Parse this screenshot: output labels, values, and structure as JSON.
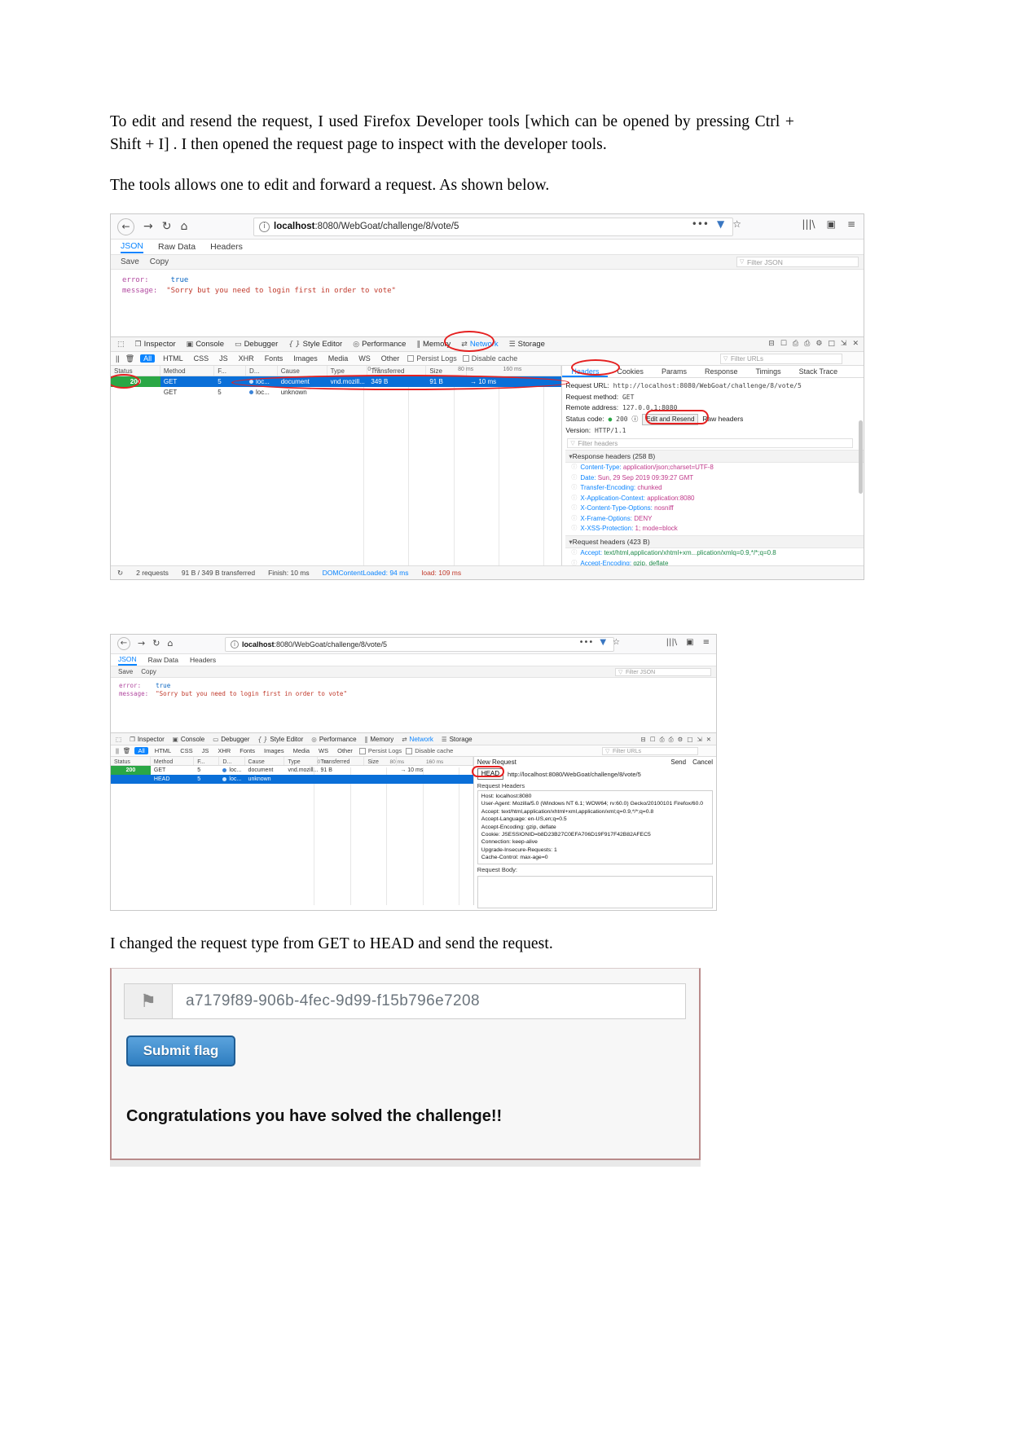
{
  "document": {
    "paragraph_1": "To edit and resend the request, I used Firefox Developer tools [which can be opened by pressing Ctrl + Shift + I] .  I then opened the request page to inspect with the developer tools.",
    "paragraph_2": "The tools allows one to edit and forward a request. As shown below.",
    "paragraph_3": "I changed the request type from GET to HEAD and send the request."
  },
  "browser": {
    "nav": {
      "back_icon": "←",
      "forward_icon": "→",
      "reload_icon": "↻",
      "home_icon": "⌂",
      "url": "localhost",
      "url_rest": ":8080/WebGoat/challenge/8/vote/5",
      "info_icon": "i",
      "menu_dots": "•••",
      "shield_icon": "▼",
      "star_icon": "☆",
      "library_icon": "|||\\",
      "sidebar_icon": "▣",
      "hamburger_icon": "≡"
    },
    "json_viewer": {
      "tabs": [
        "JSON",
        "Raw Data",
        "Headers"
      ],
      "selected_tab": "JSON",
      "actions": [
        "Save",
        "Copy"
      ],
      "filter_placeholder": "Filter JSON",
      "rows": [
        {
          "key": "error:",
          "value": "true",
          "type": "bool"
        },
        {
          "key": "message:",
          "value": "\"Sorry but you need to login first in order to vote\"",
          "type": "string"
        }
      ]
    }
  },
  "devtools": {
    "toolbar": {
      "picker_icon": "⬚",
      "tabs": [
        {
          "label": "Inspector",
          "icon": "❐"
        },
        {
          "label": "Console",
          "icon": "▣"
        },
        {
          "label": "Debugger",
          "icon": "▭"
        },
        {
          "label": "Style Editor",
          "icon": "{ }"
        },
        {
          "label": "Performance",
          "icon": "◎"
        },
        {
          "label": "Memory",
          "icon": "‖"
        },
        {
          "label": "Network",
          "icon": "⇄"
        },
        {
          "label": "Storage",
          "icon": "☰"
        }
      ],
      "active_tab": "Network",
      "right_icons": [
        "⊟",
        "☐",
        "⎙",
        "⎙",
        "⚙",
        "□",
        "⇲",
        "✕"
      ]
    },
    "filterbar": {
      "pause_icon": "||",
      "trash_icon": "🗑",
      "types": [
        "All",
        "HTML",
        "CSS",
        "JS",
        "XHR",
        "Fonts",
        "Images",
        "Media",
        "WS",
        "Other"
      ],
      "active_type": "All",
      "checkboxes": [
        "Persist Logs",
        "Disable cache"
      ],
      "filter_placeholder": "Filter URLs",
      "end_icon": "▣"
    },
    "network_columns": [
      "Status",
      "Method",
      "F...",
      "D...",
      "Cause",
      "Type",
      "Transferred",
      "Size",
      ""
    ],
    "timeline_ticks": [
      "0 ms",
      "80 ms",
      "160 ms"
    ],
    "requests": [
      {
        "status": "200",
        "method": "GET",
        "file": "5",
        "domain": "loc...",
        "cause": "document",
        "type": "vnd.mozill...",
        "transferred": "349 B",
        "size": "91 B",
        "time": "→ 10 ms",
        "selected": true
      },
      {
        "status": "",
        "method": "GET",
        "file": "5",
        "domain": "loc...",
        "cause": "unknown",
        "type": "",
        "transferred": "",
        "size": "",
        "time": "",
        "selected": false
      }
    ],
    "detail_tabs": [
      "Headers",
      "Cookies",
      "Params",
      "Response",
      "Timings",
      "Stack Trace"
    ],
    "detail_active_tab": "Headers",
    "request_summary": [
      {
        "label": "Request URL:",
        "value": "http://localhost:8080/WebGoat/challenge/8/vote/5"
      },
      {
        "label": "Request method:",
        "value": "GET"
      },
      {
        "label": "Remote address:",
        "value": "127.0.0.1:8080"
      }
    ],
    "status_code_label": "Status code:",
    "status_code_value": "200",
    "help_icon": "?",
    "edit_and_resend_label": "Edit and Resend",
    "raw_headers_label": "Raw headers",
    "version_label": "Version:",
    "version_value": "HTTP/1.1",
    "header_filter_placeholder": "Filter headers",
    "response_headers_title": "Response headers (258 B)",
    "response_headers": [
      {
        "name": "Content-Type:",
        "value": "application/json;charset=UTF-8"
      },
      {
        "name": "Date:",
        "value": "Sun, 29 Sep 2019 09:39:27 GMT"
      },
      {
        "name": "Transfer-Encoding:",
        "value": "chunked"
      },
      {
        "name": "X-Application-Context:",
        "value": "application:8080"
      },
      {
        "name": "X-Content-Type-Options:",
        "value": "nosniff"
      },
      {
        "name": "X-Frame-Options:",
        "value": "DENY"
      },
      {
        "name": "X-XSS-Protection:",
        "value": "1; mode=block"
      }
    ],
    "request_headers_title": "Request headers (423 B)",
    "request_headers": [
      {
        "name": "Accept:",
        "value": "text/html,application/xhtml+xm...plication/xmlq=0.9,*/*;q=0.8"
      },
      {
        "name": "Accept-Encoding:",
        "value": "gzip, deflate"
      }
    ],
    "statusbar": {
      "refresh_icon": "↻",
      "requests": "2 requests",
      "transferred": "91 B / 349 B transferred",
      "finish": "Finish: 10 ms",
      "domcontentloaded": "DOMContentLoaded: 94 ms",
      "load": "load: 109 ms"
    }
  },
  "devtools2": {
    "new_request": {
      "title": "New Request",
      "send_label": "Send",
      "cancel_label": "Cancel",
      "method": "HEAD",
      "url": "http://localhost:8080/WebGoat/challenge/8/vote/5",
      "request_headers_label": "Request Headers",
      "headers_text": [
        "Host: localhost:8080",
        "User-Agent: Mozilla/5.0 (Windows NT 6.1; WOW64; rv:60.0) Gecko/20100101 Firefox/60.0",
        "Accept: text/html,application/xhtml+xml,application/xml;q=0.9,*/*;q=0.8",
        "Accept-Language: en-US,en;q=0.5",
        "Accept-Encoding: gzip, deflate",
        "Cookie: JSESSIONID=b8D23B27C0EFA706D19F917F42B82AFEC5",
        "Connection: keep-alive",
        "Upgrade-Insecure-Requests: 1",
        "Cache-Control: max-age=0"
      ],
      "request_body_label": "Request Body:"
    },
    "requests": [
      {
        "status": "200",
        "method": "GET",
        "file": "5",
        "domain": "loc...",
        "cause": "document",
        "type": "vnd.mozill...349 B",
        "transferred": "91 B",
        "size": "",
        "time": "→ 10 ms",
        "selected": false
      },
      {
        "status": "",
        "method": "HEAD",
        "file": "5",
        "domain": "loc...",
        "cause": "unknown",
        "type": "",
        "transferred": "",
        "size": "",
        "time": "",
        "selected": true
      }
    ]
  },
  "flag_panel": {
    "flag_icon": "⚑",
    "flag_value": "a7179f89-906b-4fec-9d99-f15b796e7208",
    "submit_label": "Submit flag",
    "congrats_text": "Congratulations you have solved the challenge!!"
  },
  "colors": {
    "accent_blue": "#0a84ff",
    "selected_row": "#0a6fd8",
    "status_green": "#2aa745",
    "annotation_red": "#e52020",
    "header_name": "#0a84ff",
    "header_value": "#c0398b"
  }
}
